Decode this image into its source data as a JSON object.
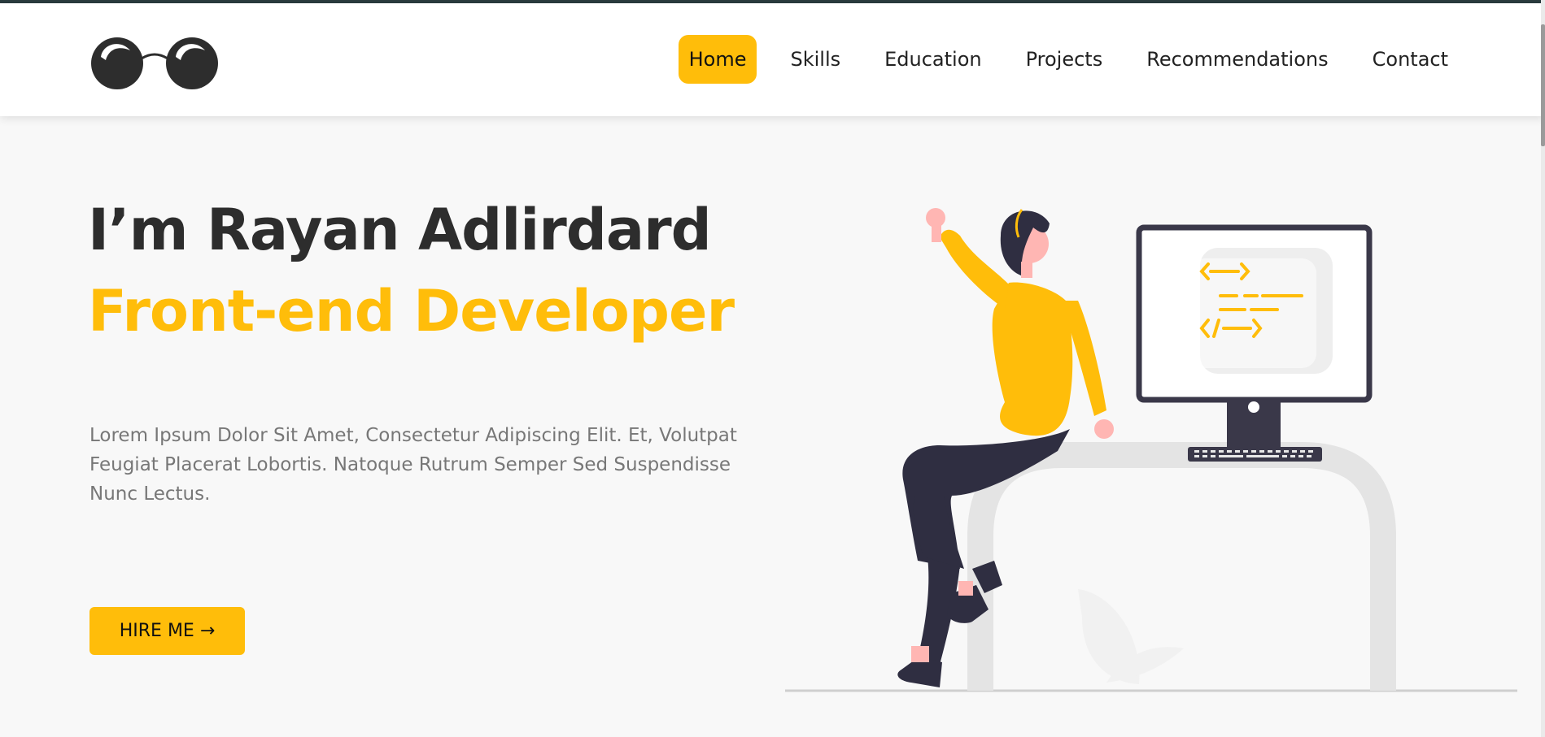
{
  "brand": {
    "logo_icon": "glasses-icon",
    "accent_color": "#ffbd0a",
    "dark_color": "#2d2d2d"
  },
  "nav": {
    "items": [
      {
        "label": "Home",
        "active": true
      },
      {
        "label": "Skills"
      },
      {
        "label": "Education"
      },
      {
        "label": "Projects"
      },
      {
        "label": "Recommendations"
      },
      {
        "label": "Contact"
      }
    ]
  },
  "hero": {
    "title": "I’m Rayan Adlirdard",
    "role": "Front-end Developer",
    "description": "Lorem Ipsum Dolor Sit Amet, Consectetur Adipiscing Elit. Et, Volutpat Feugiat Placerat Lobortis. Natoque Rutrum Semper Sed Suspendisse Nunc Lectus.",
    "cta_label": "HIRE ME →",
    "illustration": "developer-at-desk-illustration"
  }
}
